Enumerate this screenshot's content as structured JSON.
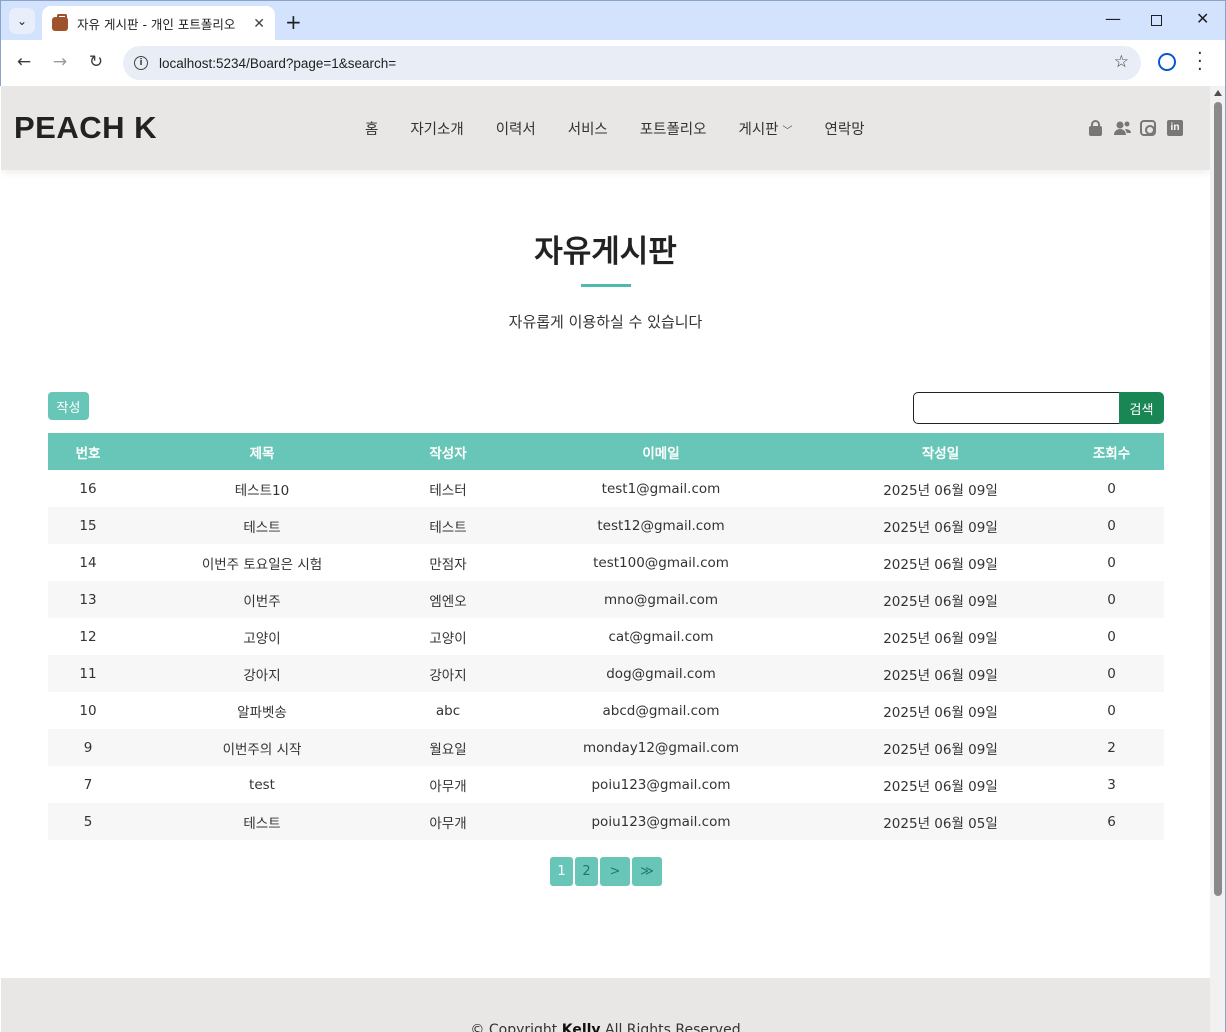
{
  "browser": {
    "tab_title": "자유 게시판 - 개인 포트폴리오",
    "url": "localhost:5234/Board?page=1&search="
  },
  "site": {
    "logo": "PEACH K",
    "menu": [
      "홈",
      "자기소개",
      "이력서",
      "서비스",
      "포트폴리오",
      "게시판",
      "연락망"
    ],
    "social_icons": [
      "lock-icon",
      "people-icon",
      "instagram-icon",
      "linkedin-icon"
    ]
  },
  "board": {
    "title": "자유게시판",
    "subtitle": "자유롭게 이용하실 수 있습니다",
    "write_label": "작성",
    "search_value": "",
    "search_label": "검색",
    "columns": [
      "번호",
      "제목",
      "작성자",
      "이메일",
      "작성일",
      "조회수"
    ],
    "rows": [
      {
        "no": "16",
        "title": "테스트10",
        "author": "테스터",
        "email": "test1@gmail.com",
        "date": "2025년 06월 09일",
        "views": "0"
      },
      {
        "no": "15",
        "title": "테스트",
        "author": "테스트",
        "email": "test12@gmail.com",
        "date": "2025년 06월 09일",
        "views": "0"
      },
      {
        "no": "14",
        "title": "이번주 토요일은 시험",
        "author": "만점자",
        "email": "test100@gmail.com",
        "date": "2025년 06월 09일",
        "views": "0"
      },
      {
        "no": "13",
        "title": "이번주",
        "author": "엠엔오",
        "email": "mno@gmail.com",
        "date": "2025년 06월 09일",
        "views": "0"
      },
      {
        "no": "12",
        "title": "고양이",
        "author": "고양이",
        "email": "cat@gmail.com",
        "date": "2025년 06월 09일",
        "views": "0"
      },
      {
        "no": "11",
        "title": "강아지",
        "author": "강아지",
        "email": "dog@gmail.com",
        "date": "2025년 06월 09일",
        "views": "0"
      },
      {
        "no": "10",
        "title": "알파벳송",
        "author": "abc",
        "email": "abcd@gmail.com",
        "date": "2025년 06월 09일",
        "views": "0"
      },
      {
        "no": "9",
        "title": "이번주의 시작",
        "author": "월요일",
        "email": "monday12@gmail.com",
        "date": "2025년 06월 09일",
        "views": "2"
      },
      {
        "no": "7",
        "title": "test",
        "author": "아무개",
        "email": "poiu123@gmail.com",
        "date": "2025년 06월 09일",
        "views": "3"
      },
      {
        "no": "5",
        "title": "테스트",
        "author": "아무개",
        "email": "poiu123@gmail.com",
        "date": "2025년 06월 05일",
        "views": "6"
      }
    ],
    "pagination": [
      "1",
      "2",
      ">",
      "≫"
    ]
  },
  "footer": {
    "prefix": "© Copyright ",
    "name": "Kelly",
    "suffix": " All Rights Reserved"
  },
  "colors": {
    "accent": "#68c6b9",
    "search_button": "#198754",
    "header_bg": "#e8e7e5"
  }
}
